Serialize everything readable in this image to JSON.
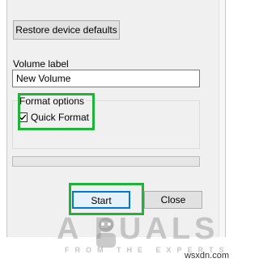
{
  "buttons": {
    "restore": "Restore device defaults",
    "start": "Start",
    "close": "Close"
  },
  "volume": {
    "label": "Volume label",
    "value": "New Volume"
  },
  "format_options": {
    "legend": "Format options",
    "quick_format_label": "Quick Format",
    "quick_format_checked": true
  },
  "progress": {
    "value": 0
  },
  "watermark": {
    "logo_text": "A  PUALS",
    "tagline": "FROM THE EXPERTS",
    "site": "wsxdn.com"
  },
  "colors": {
    "highlight": "#1fb339",
    "accent": "#0078d7",
    "dialog_bg": "#f0f0f0"
  },
  "icons": [
    "check-icon",
    "mascot-icon"
  ]
}
